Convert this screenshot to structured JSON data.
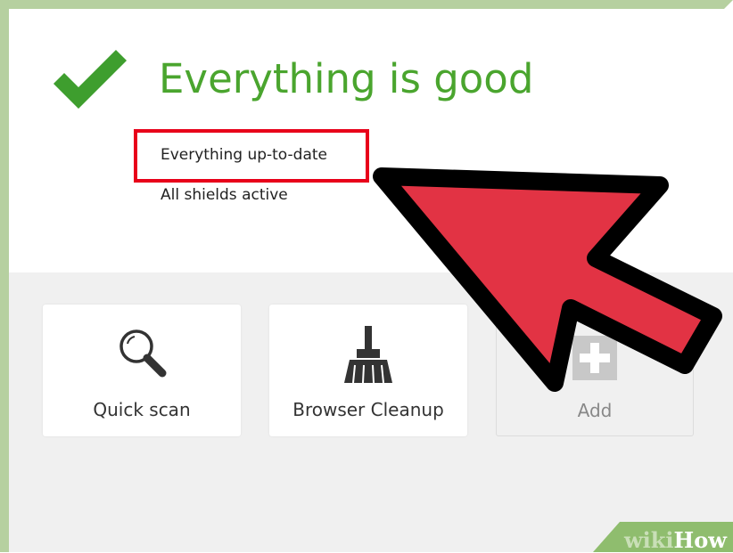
{
  "status": {
    "title": "Everything is good",
    "lines": [
      "Everything up-to-date",
      "All shields active"
    ]
  },
  "tiles": [
    {
      "label": "Quick scan",
      "icon": "magnifier-icon"
    },
    {
      "label": "Browser Cleanup",
      "icon": "broom-icon"
    },
    {
      "label": "Add",
      "icon": "plus-icon"
    }
  ],
  "watermark": {
    "prefix": "wiki",
    "suffix": "How"
  },
  "colors": {
    "status_green": "#4aa52e",
    "highlight_red": "#e8001a",
    "arrow_red": "#e23344",
    "frame_green": "#b6d0a0"
  }
}
